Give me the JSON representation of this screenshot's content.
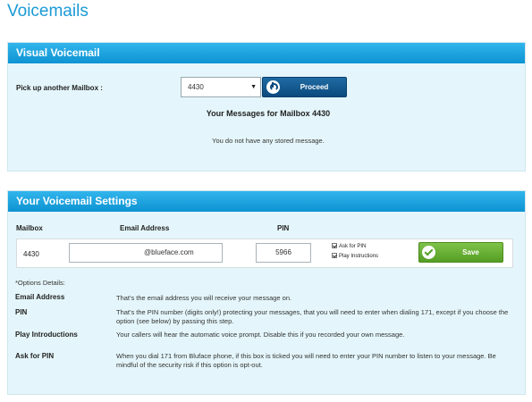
{
  "page": {
    "title": "Voicemails"
  },
  "visual_voicemail": {
    "header": "Visual Voicemail",
    "pick_label": "Pick up another Mailbox :",
    "mailbox_selected": "4430",
    "proceed_label": "Proceed",
    "messages_title": "Your Messages for Mailbox 4430",
    "no_message_text": "You do not have any stored message."
  },
  "settings": {
    "header": "Your Voicemail Settings",
    "columns": {
      "mailbox": "Mailbox",
      "email": "Email Address",
      "pin": "PIN"
    },
    "row": {
      "mailbox": "4430",
      "email": "@blueface.com",
      "pin": "5966",
      "ask_for_pin_label": "Ask for PIN",
      "ask_for_pin_checked": true,
      "play_instructions_label": "Play Instructions",
      "play_instructions_checked": true,
      "save_label": "Save"
    },
    "options_details_label": "*Options Details:",
    "options": [
      {
        "term": "Email Address",
        "desc": "That's the email address you will receive your message on."
      },
      {
        "term": "PIN",
        "desc": "That's the PIN number (digits only!) protecting your messages, that you will need to enter when dialing 171, except if you choose the option (see below) by passing this step."
      },
      {
        "term": "Play Introductions",
        "desc": "Your callers will hear the automatic voice prompt. Disable this if you recorded your own message."
      },
      {
        "term": "Ask for PIN",
        "desc": "When you dial 171 from Bluface phone, if this box is ticked you will need to enter your PIN number to listen to your message. Be mindful of the security risk if this option is opt-out."
      }
    ]
  },
  "icons": {
    "proceed": "power-icon",
    "save": "checkmark-icon",
    "dropdown": "caret-down-icon"
  },
  "colors": {
    "accent": "#1a9ad6",
    "header_blue": "#0d93d2",
    "panel_bg": "#e4f6fb",
    "proceed_bg": "#0b4a7e",
    "save_bg": "#559e24"
  }
}
